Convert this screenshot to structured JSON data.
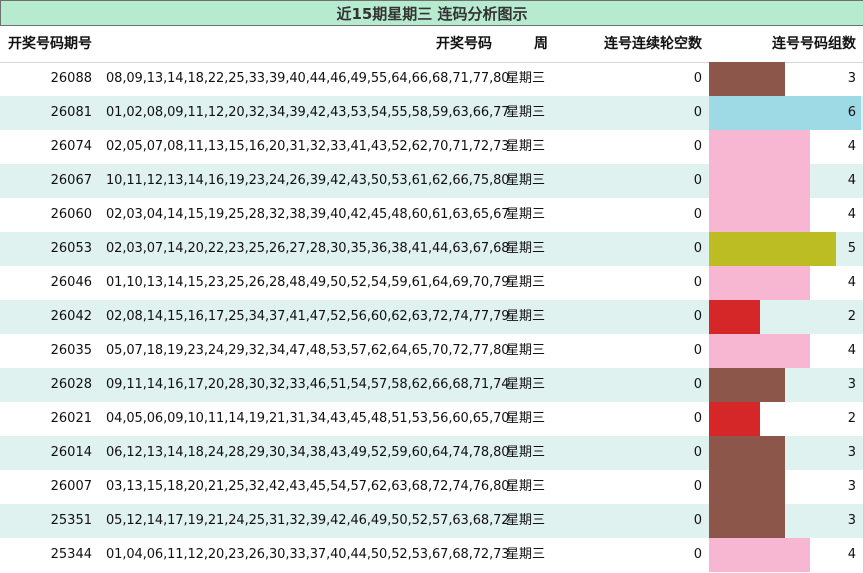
{
  "title": "近15期星期三 连码分析图示",
  "headers": {
    "issue": "开奖号码期号",
    "numbers": "开奖号码",
    "weekday": "周",
    "gap": "连号连续轮空数",
    "groups": "连号号码组数"
  },
  "chart_data": {
    "type": "bar",
    "title": "近15期星期三 连码分析图示",
    "xlabel": "连号号码组数",
    "categories": [
      "26088",
      "26081",
      "26074",
      "26067",
      "26060",
      "26053",
      "26046",
      "26042",
      "26035",
      "26028",
      "26021",
      "26014",
      "26007",
      "25351",
      "25344"
    ],
    "values": [
      3,
      6,
      4,
      4,
      4,
      5,
      4,
      2,
      4,
      3,
      2,
      3,
      3,
      3,
      4
    ],
    "xlim": [
      0,
      6
    ],
    "value_colors": {
      "2": "#d62728",
      "3": "#8c564b",
      "4": "#f7b6d2",
      "5": "#bcbd22",
      "6": "#9edae5"
    },
    "rows": [
      {
        "issue": "26088",
        "numbers": "08,09,13,14,18,22,25,33,39,40,44,46,49,55,64,66,68,71,77,80",
        "weekday": "星期三",
        "gap": "0",
        "groups": "3"
      },
      {
        "issue": "26081",
        "numbers": "01,02,08,09,11,12,20,32,34,39,42,43,53,54,55,58,59,63,66,77",
        "weekday": "星期三",
        "gap": "0",
        "groups": "6"
      },
      {
        "issue": "26074",
        "numbers": "02,05,07,08,11,13,15,16,20,31,32,33,41,43,52,62,70,71,72,73",
        "weekday": "星期三",
        "gap": "0",
        "groups": "4"
      },
      {
        "issue": "26067",
        "numbers": "10,11,12,13,14,16,19,23,24,26,39,42,43,50,53,61,62,66,75,80",
        "weekday": "星期三",
        "gap": "0",
        "groups": "4"
      },
      {
        "issue": "26060",
        "numbers": "02,03,04,14,15,19,25,28,32,38,39,40,42,45,48,60,61,63,65,67",
        "weekday": "星期三",
        "gap": "0",
        "groups": "4"
      },
      {
        "issue": "26053",
        "numbers": "02,03,07,14,20,22,23,25,26,27,28,30,35,36,38,41,44,63,67,68",
        "weekday": "星期三",
        "gap": "0",
        "groups": "5"
      },
      {
        "issue": "26046",
        "numbers": "01,10,13,14,15,23,25,26,28,48,49,50,52,54,59,61,64,69,70,79",
        "weekday": "星期三",
        "gap": "0",
        "groups": "4"
      },
      {
        "issue": "26042",
        "numbers": "02,08,14,15,16,17,25,34,37,41,47,52,56,60,62,63,72,74,77,79",
        "weekday": "星期三",
        "gap": "0",
        "groups": "2"
      },
      {
        "issue": "26035",
        "numbers": "05,07,18,19,23,24,29,32,34,47,48,53,57,62,64,65,70,72,77,80",
        "weekday": "星期三",
        "gap": "0",
        "groups": "4"
      },
      {
        "issue": "26028",
        "numbers": "09,11,14,16,17,20,28,30,32,33,46,51,54,57,58,62,66,68,71,74",
        "weekday": "星期三",
        "gap": "0",
        "groups": "3"
      },
      {
        "issue": "26021",
        "numbers": "04,05,06,09,10,11,14,19,21,31,34,43,45,48,51,53,56,60,65,70",
        "weekday": "星期三",
        "gap": "0",
        "groups": "2"
      },
      {
        "issue": "26014",
        "numbers": "06,12,13,14,18,24,28,29,30,34,38,43,49,52,59,60,64,74,78,80",
        "weekday": "星期三",
        "gap": "0",
        "groups": "3"
      },
      {
        "issue": "26007",
        "numbers": "03,13,15,18,20,21,25,32,42,43,45,54,57,62,63,68,72,74,76,80",
        "weekday": "星期三",
        "gap": "0",
        "groups": "3"
      },
      {
        "issue": "25351",
        "numbers": "05,12,14,17,19,21,24,25,31,32,39,42,46,49,50,52,57,63,68,72",
        "weekday": "星期三",
        "gap": "0",
        "groups": "3"
      },
      {
        "issue": "25344",
        "numbers": "01,04,06,11,12,20,23,26,30,33,37,40,44,50,52,53,67,68,72,73",
        "weekday": "星期三",
        "gap": "0",
        "groups": "4"
      }
    ]
  }
}
